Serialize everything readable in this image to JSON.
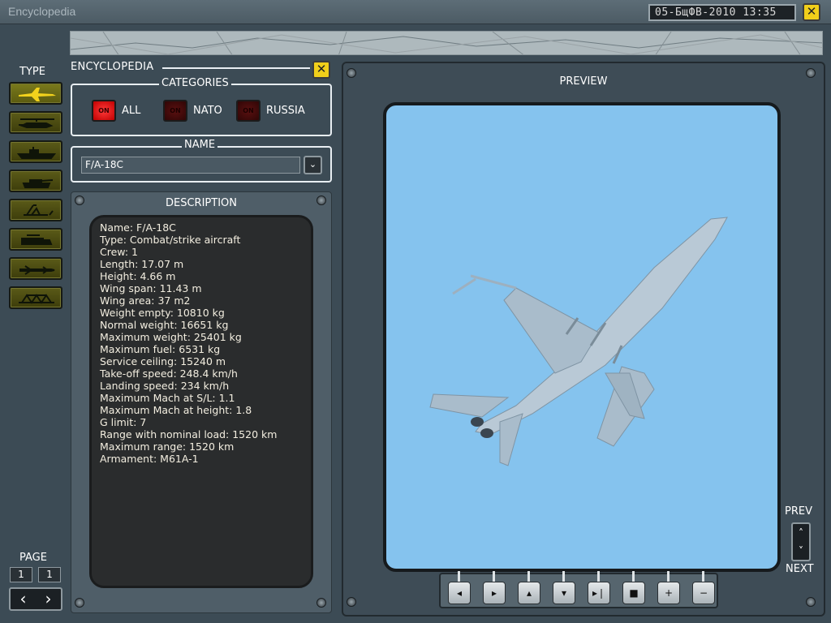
{
  "titlebar": {
    "title": "Encyclopedia",
    "clock": "05-БщФВ-2010  13:35",
    "close_icon": "close-icon"
  },
  "sidebar": {
    "type_label": "TYPE",
    "types": [
      {
        "icon": "aircraft-icon",
        "active": true
      },
      {
        "icon": "helicopter-icon",
        "active": false
      },
      {
        "icon": "ship-icon",
        "active": false
      },
      {
        "icon": "tank-icon",
        "active": false
      },
      {
        "icon": "missile-launcher-icon",
        "active": false
      },
      {
        "icon": "truck-icon",
        "active": false
      },
      {
        "icon": "missile-icon",
        "active": false
      },
      {
        "icon": "bridge-icon",
        "active": false
      }
    ],
    "page_label": "PAGE",
    "page_current": "1",
    "page_total": "1",
    "prev_page_glyph": "‹",
    "next_page_glyph": "›"
  },
  "encyclopedia": {
    "label": "ENCYCLOPEDIA",
    "close_glyph": "✕",
    "categories": {
      "title": "CATEGORIES",
      "items": [
        {
          "label": "ALL",
          "state": "ON",
          "on": true
        },
        {
          "label": "NATO",
          "state": "ON",
          "on": false
        },
        {
          "label": "RUSSIA",
          "state": "ON",
          "on": false
        }
      ]
    },
    "name": {
      "title": "NAME",
      "value": "F/A-18C",
      "dropdown_glyph": "⌄"
    }
  },
  "description": {
    "title": "DESCRIPTION",
    "lines": [
      "Name: F/A-18C",
      "Type: Combat/strike aircraft",
      "Crew: 1",
      "Length: 17.07 m",
      "Height: 4.66 m",
      "Wing span: 11.43 m",
      "Wing area: 37 m2",
      "Weight empty: 10810 kg",
      "Normal weight: 16651 kg",
      "Maximum weight: 25401 kg",
      "Maximum fuel: 6531 kg",
      "Service ceiling: 15240 m",
      "Take-off speed: 248.4 km/h",
      "Landing speed: 234 km/h",
      "Maximum Mach at S/L: 1.1",
      "Maximum Mach at height: 1.8",
      "G limit: 7",
      "Range with nominal load: 1520 km",
      "Maximum range: 1520 km",
      "Armament: M61A-1"
    ]
  },
  "preview": {
    "title": "PREVIEW",
    "prev_label": "PREV",
    "next_label": "NEXT",
    "up_glyph": "˄",
    "down_glyph": "˅",
    "sky_color": "#85c3ee",
    "controls": [
      {
        "name": "rotate-left-button",
        "glyph": "◂"
      },
      {
        "name": "rotate-right-button",
        "glyph": "▸"
      },
      {
        "name": "rotate-up-button",
        "glyph": "▴"
      },
      {
        "name": "rotate-down-button",
        "glyph": "▾"
      },
      {
        "name": "play-button",
        "glyph": "▸❘"
      },
      {
        "name": "stop-button",
        "glyph": "■"
      },
      {
        "name": "zoom-in-button",
        "glyph": "+"
      },
      {
        "name": "zoom-out-button",
        "glyph": "−"
      }
    ]
  }
}
